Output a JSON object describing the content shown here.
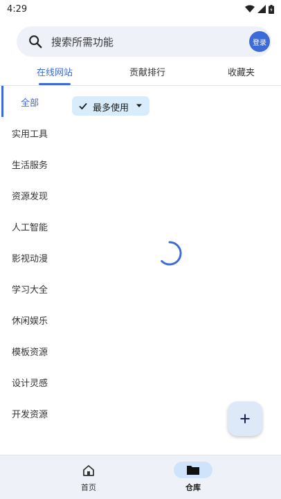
{
  "status_bar": {
    "time": "4:29"
  },
  "search": {
    "placeholder": "搜索所需功能",
    "login_label": "登录"
  },
  "tabs": [
    {
      "label": "在线网站",
      "active": true
    },
    {
      "label": "贡献排行",
      "active": false
    },
    {
      "label": "收藏夹",
      "active": false
    }
  ],
  "sidebar": {
    "items": [
      {
        "label": "全部",
        "active": true
      },
      {
        "label": "实用工具"
      },
      {
        "label": "生活服务"
      },
      {
        "label": "资源发现"
      },
      {
        "label": "人工智能"
      },
      {
        "label": "影视动漫"
      },
      {
        "label": "学习大全"
      },
      {
        "label": "休闲娱乐"
      },
      {
        "label": "模板资源"
      },
      {
        "label": "设计灵感"
      },
      {
        "label": "开发资源"
      }
    ]
  },
  "filter": {
    "selected": "最多使用"
  },
  "bottom_nav": [
    {
      "label": "首页",
      "active": false
    },
    {
      "label": "仓库",
      "active": true
    }
  ],
  "colors": {
    "accent": "#3c6ad6",
    "chip_bg": "#d8ecfb",
    "search_bg": "#eef1f8",
    "nav_bg": "#eef1f7",
    "fab_bg": "#dde9f8"
  },
  "icons": {
    "status": [
      "wifi-icon",
      "signal-icon",
      "battery-icon"
    ],
    "search": "search-icon",
    "chip": [
      "check-icon",
      "dropdown-arrow-icon"
    ],
    "fab": "plus-icon",
    "nav": [
      "home-icon",
      "folder-icon"
    ]
  }
}
